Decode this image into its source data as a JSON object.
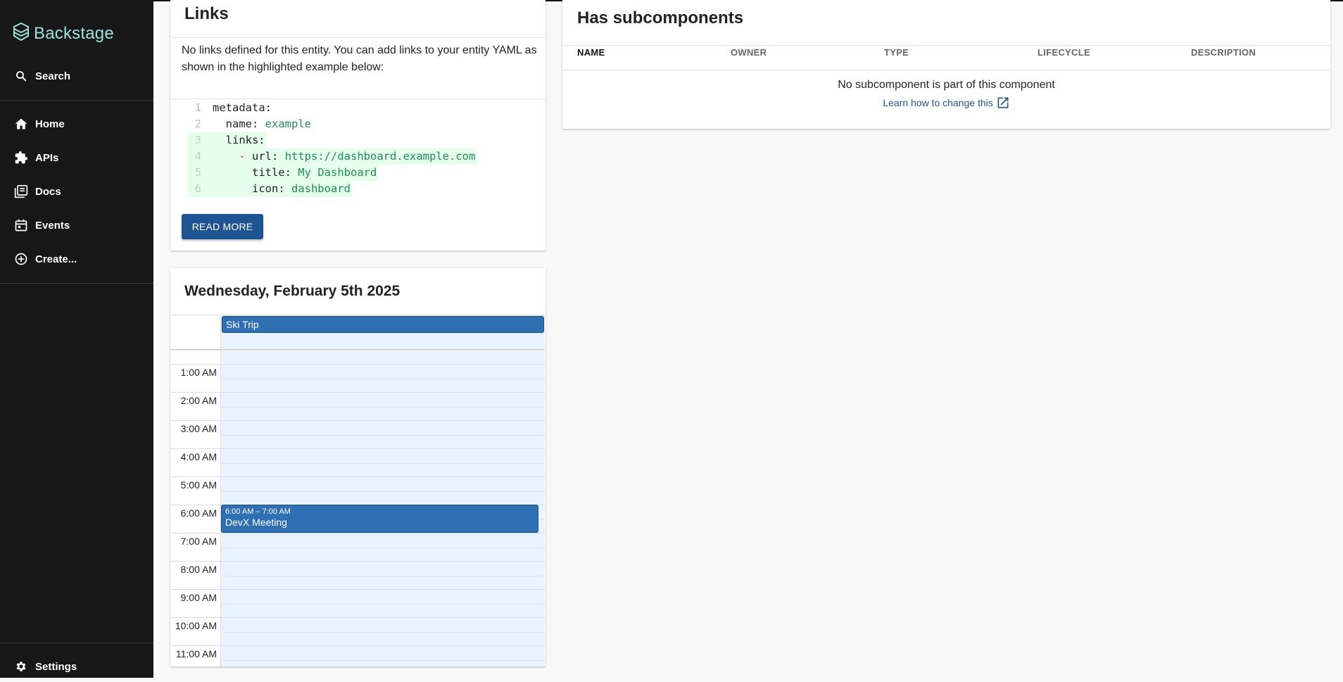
{
  "app": {
    "name": "Backstage"
  },
  "sidebar": {
    "search_label": "Search",
    "items": [
      {
        "label": "Home",
        "icon": "home-icon"
      },
      {
        "label": "APIs",
        "icon": "puzzle-icon"
      },
      {
        "label": "Docs",
        "icon": "library-icon"
      },
      {
        "label": "Events",
        "icon": "calendar-icon"
      },
      {
        "label": "Create...",
        "icon": "add-circle-icon"
      }
    ],
    "settings_label": "Settings"
  },
  "links_card": {
    "title": "Links",
    "description": "No links defined for this entity. You can add links to your entity YAML as shown in the highlighted example below:",
    "code_lines": [
      {
        "n": "1",
        "key": "metadata:",
        "val": ""
      },
      {
        "n": "2",
        "key": "  name: ",
        "val": "example"
      },
      {
        "n": "3",
        "key": "  links:",
        "val": ""
      },
      {
        "n": "4",
        "key": "url: ",
        "val": "https://dashboard.example.com"
      },
      {
        "n": "5",
        "key": "      title: ",
        "val": "My Dashboard"
      },
      {
        "n": "6",
        "key": "      icon: ",
        "val": "dashboard"
      }
    ],
    "button_label": "READ MORE"
  },
  "calendar_card": {
    "title": "Wednesday, February 5th 2025",
    "all_day_event": "Ski Trip",
    "time_labels": [
      "1:00 AM",
      "2:00 AM",
      "3:00 AM",
      "4:00 AM",
      "5:00 AM",
      "6:00 AM",
      "7:00 AM",
      "8:00 AM",
      "9:00 AM",
      "10:00 AM",
      "11:00 AM"
    ],
    "event": {
      "time": "6:00 AM – 7:00 AM",
      "title": "DevX Meeting"
    }
  },
  "subcomponents_card": {
    "title": "Has subcomponents",
    "columns": [
      "NAME",
      "OWNER",
      "TYPE",
      "LIFECYCLE",
      "DESCRIPTION"
    ],
    "empty_message": "No subcomponent is part of this component",
    "learn_link": "Learn how to change this"
  },
  "colors": {
    "accent": "#1f5493",
    "event": "#2f6fb3",
    "sidebar": "#171717",
    "logo": "#9be1d8"
  }
}
